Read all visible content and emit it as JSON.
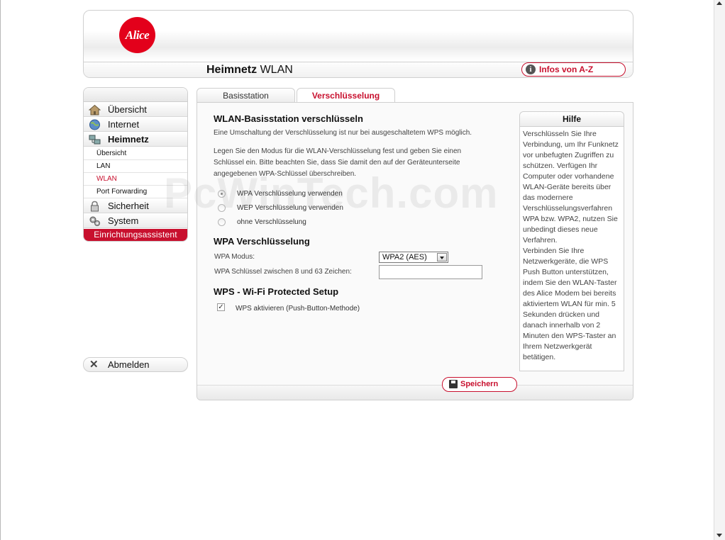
{
  "header": {
    "logo_text": "Alice",
    "title_bold": "Heimnetz",
    "title_rest": " WLAN",
    "infos_button": "Infos von A-Z"
  },
  "nav": {
    "items": [
      {
        "label": "Übersicht",
        "icon": "home-icon"
      },
      {
        "label": "Internet",
        "icon": "globe-icon"
      },
      {
        "label": "Heimnetz",
        "icon": "network-icon"
      },
      {
        "label": "Sicherheit",
        "icon": "lock-icon"
      },
      {
        "label": "System",
        "icon": "gears-icon"
      }
    ],
    "sub_items": [
      "Übersicht",
      "LAN",
      "WLAN",
      "Port Forwarding"
    ],
    "assistant": "Einrichtungsassistent",
    "logout": "Abmelden"
  },
  "tabs": [
    {
      "label": "Basisstation"
    },
    {
      "label": "Verschlüsselung"
    }
  ],
  "content": {
    "heading1": "WLAN-Basisstation verschlüsseln",
    "note": "Eine Umschaltung der Verschlüsselung ist nur bei ausgeschaltetem WPS möglich.",
    "intro_line1": "Legen Sie den Modus für die WLAN-Verschlüsselung fest und geben Sie einen",
    "intro_line2": "Schlüssel ein. Bitte beachten Sie, dass Sie damit den auf der Geräteunterseite",
    "intro_line3": "angegebenen WPA-Schlüssel überschreiben.",
    "radio_options": [
      "WPA Verschlüsselung verwenden",
      "WEP Verschlüsselung verwenden",
      "ohne Verschlüsselung"
    ],
    "heading2": "WPA Verschlüsselung",
    "wpa_mode_label": "WPA Modus:",
    "wpa_mode_value": "WPA2 (AES)",
    "wpa_key_label": "WPA Schlüssel zwischen 8 und 63 Zeichen:",
    "wpa_key_value": "",
    "heading3": "WPS - Wi-Fi Protected Setup",
    "wps_label": "WPS aktivieren (Push-Button-Methode)",
    "save_button": "Speichern"
  },
  "help": {
    "title": "Hilfe",
    "body": "Verschlüsseln Sie Ihre Verbindung, um Ihr Funknetz vor unbefugten Zugriffen zu schützen. Verfügen Ihr Computer oder vorhandene WLAN-Geräte bereits über das modernere Verschlüsselungsverfahren WPA bzw. WPA2, nutzen Sie unbedingt dieses neue Verfahren.\nVerbinden Sie Ihre Netzwerkgeräte, die WPS Push Button unterstützen, indem Sie den WLAN-Taster des Alice Modem bei bereits aktiviertem WLAN für min. 5 Sekunden drücken und danach innerhalb von 2 Minuten den WPS-Taster an Ihrem Netzwerkgerät betätigen."
  },
  "watermark": "PcWinTech.com",
  "colors": {
    "accent": "#c8102e",
    "logo": "#e3001b"
  }
}
